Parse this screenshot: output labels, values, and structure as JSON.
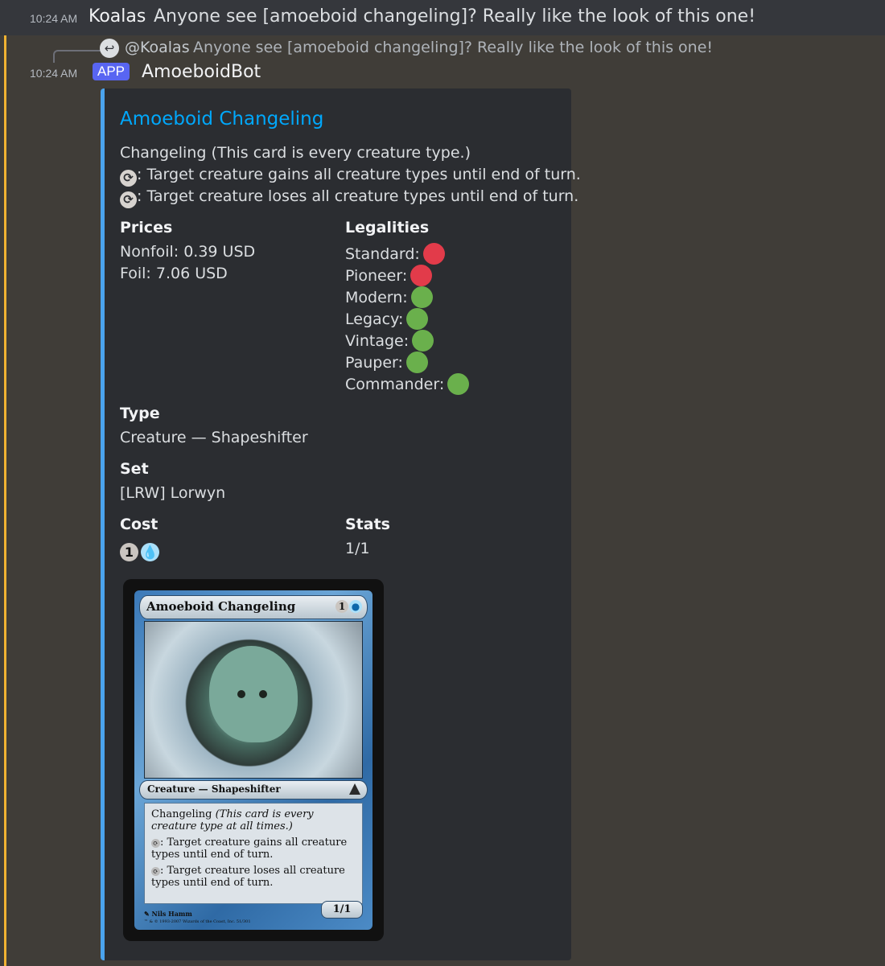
{
  "message1": {
    "timestamp": "10:24 AM",
    "author": "Koalas",
    "content": "Anyone see [amoeboid changeling]? Really like the look of this one!"
  },
  "reply": {
    "author": "@Koalas",
    "content": "Anyone see [amoeboid changeling]? Really like the look of this one!"
  },
  "message2": {
    "timestamp": "10:24 AM",
    "tag": "APP",
    "author": "AmoeboidBot"
  },
  "embed": {
    "accent_color": "#4aa3ed",
    "title": "Amoeboid Changeling",
    "description": [
      "Changeling (This card is every creature type.)",
      ": Target creature gains all creature types until end of turn.",
      ": Target creature loses all creature types until end of turn."
    ],
    "prices": {
      "name": "Prices",
      "nonfoil": "Nonfoil: 0.39 USD",
      "foil": "Foil: 7.06 USD"
    },
    "legalities": {
      "name": "Legalities",
      "items": [
        {
          "format": "Standard:",
          "status": "red"
        },
        {
          "format": "Pioneer:",
          "status": "red"
        },
        {
          "format": "Modern:",
          "status": "green"
        },
        {
          "format": "Legacy:",
          "status": "green"
        },
        {
          "format": "Vintage:",
          "status": "green"
        },
        {
          "format": "Pauper:",
          "status": "green"
        },
        {
          "format": "Commander:",
          "status": "green"
        }
      ],
      "colors": {
        "red": "#e23b4a",
        "green": "#6ab04c"
      }
    },
    "type": {
      "name": "Type",
      "value": "Creature — Shapeshifter"
    },
    "set": {
      "name": "Set",
      "value": "[LRW] Lorwyn"
    },
    "cost": {
      "name": "Cost",
      "generic": "1",
      "icon": "blue-mana-icon"
    },
    "stats": {
      "name": "Stats",
      "value": "1/1"
    }
  },
  "card": {
    "name": "Amoeboid Changeling",
    "cost_generic": "1",
    "type_line": "Creature — Shapeshifter",
    "text_changeling": "Changeling",
    "text_reminder": "(This card is every creature type at all times.)",
    "ability1": ": Target creature gains all creature types until end of turn.",
    "ability2": ": Target creature loses all creature types until end of turn.",
    "pt": "1/1",
    "artist": "Nils Hamm",
    "copyright": "™ & © 1993-2007 Wizards of the Coast, Inc. 51/301"
  }
}
